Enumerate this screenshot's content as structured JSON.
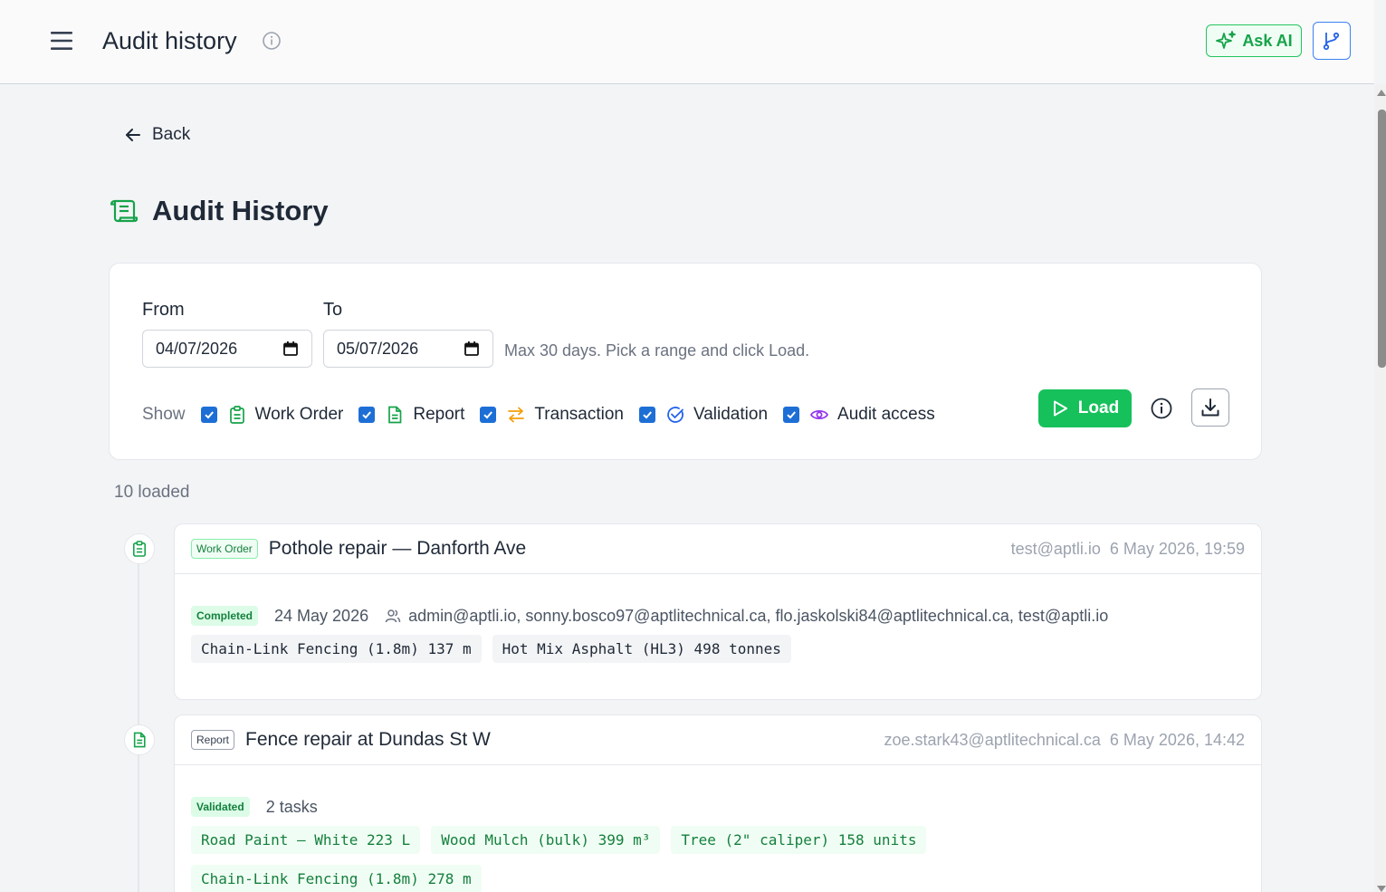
{
  "header": {
    "title": "Audit history",
    "ask_ai_label": "Ask AI"
  },
  "nav": {
    "back_label": "Back"
  },
  "page": {
    "heading": "Audit History"
  },
  "filters": {
    "from_label": "From",
    "to_label": "To",
    "from_value": "04/07/2026",
    "to_value": "05/07/2026",
    "hint": "Max 30 days. Pick a range and click Load.",
    "show_label": "Show",
    "types": [
      {
        "label": "Work Order",
        "checked": true,
        "icon": "clipboard-icon"
      },
      {
        "label": "Report",
        "checked": true,
        "icon": "document-icon"
      },
      {
        "label": "Transaction",
        "checked": true,
        "icon": "swap-arrows-icon"
      },
      {
        "label": "Validation",
        "checked": true,
        "icon": "check-circle-icon"
      },
      {
        "label": "Audit access",
        "checked": true,
        "icon": "eye-icon"
      }
    ],
    "load_label": "Load"
  },
  "results": {
    "count_text": "10 loaded",
    "entries": [
      {
        "type": "Work Order",
        "title": "Pothole repair — Danforth Ave",
        "user": "test@aptli.io",
        "timestamp": "6 May 2026, 19:59",
        "status": "Completed",
        "date": "24 May 2026",
        "assignees": "admin@aptli.io, sonny.bosco97@aptlitechnical.ca, flo.jaskolski84@aptlitechnical.ca, test@aptli.io",
        "materials": [
          "Chain-Link Fencing (1.8m) 137 m",
          "Hot Mix Asphalt (HL3) 498 tonnes"
        ]
      },
      {
        "type": "Report",
        "title": "Fence repair at Dundas St W",
        "user": "zoe.stark43@aptlitechnical.ca",
        "timestamp": "6 May 2026, 14:42",
        "status": "Validated",
        "tasks": "2 tasks",
        "materials": [
          "Road Paint – White 223 L",
          "Wood Mulch (bulk) 399 m³",
          "Tree (2\" caliper) 158 units",
          "Chain-Link Fencing (1.8m) 278 m"
        ]
      }
    ]
  },
  "colors": {
    "accent_green": "#16c15b",
    "checkbox_blue": "#1d6fd6",
    "transaction_orange": "#f59e0b",
    "audit_purple": "#9333ea"
  }
}
